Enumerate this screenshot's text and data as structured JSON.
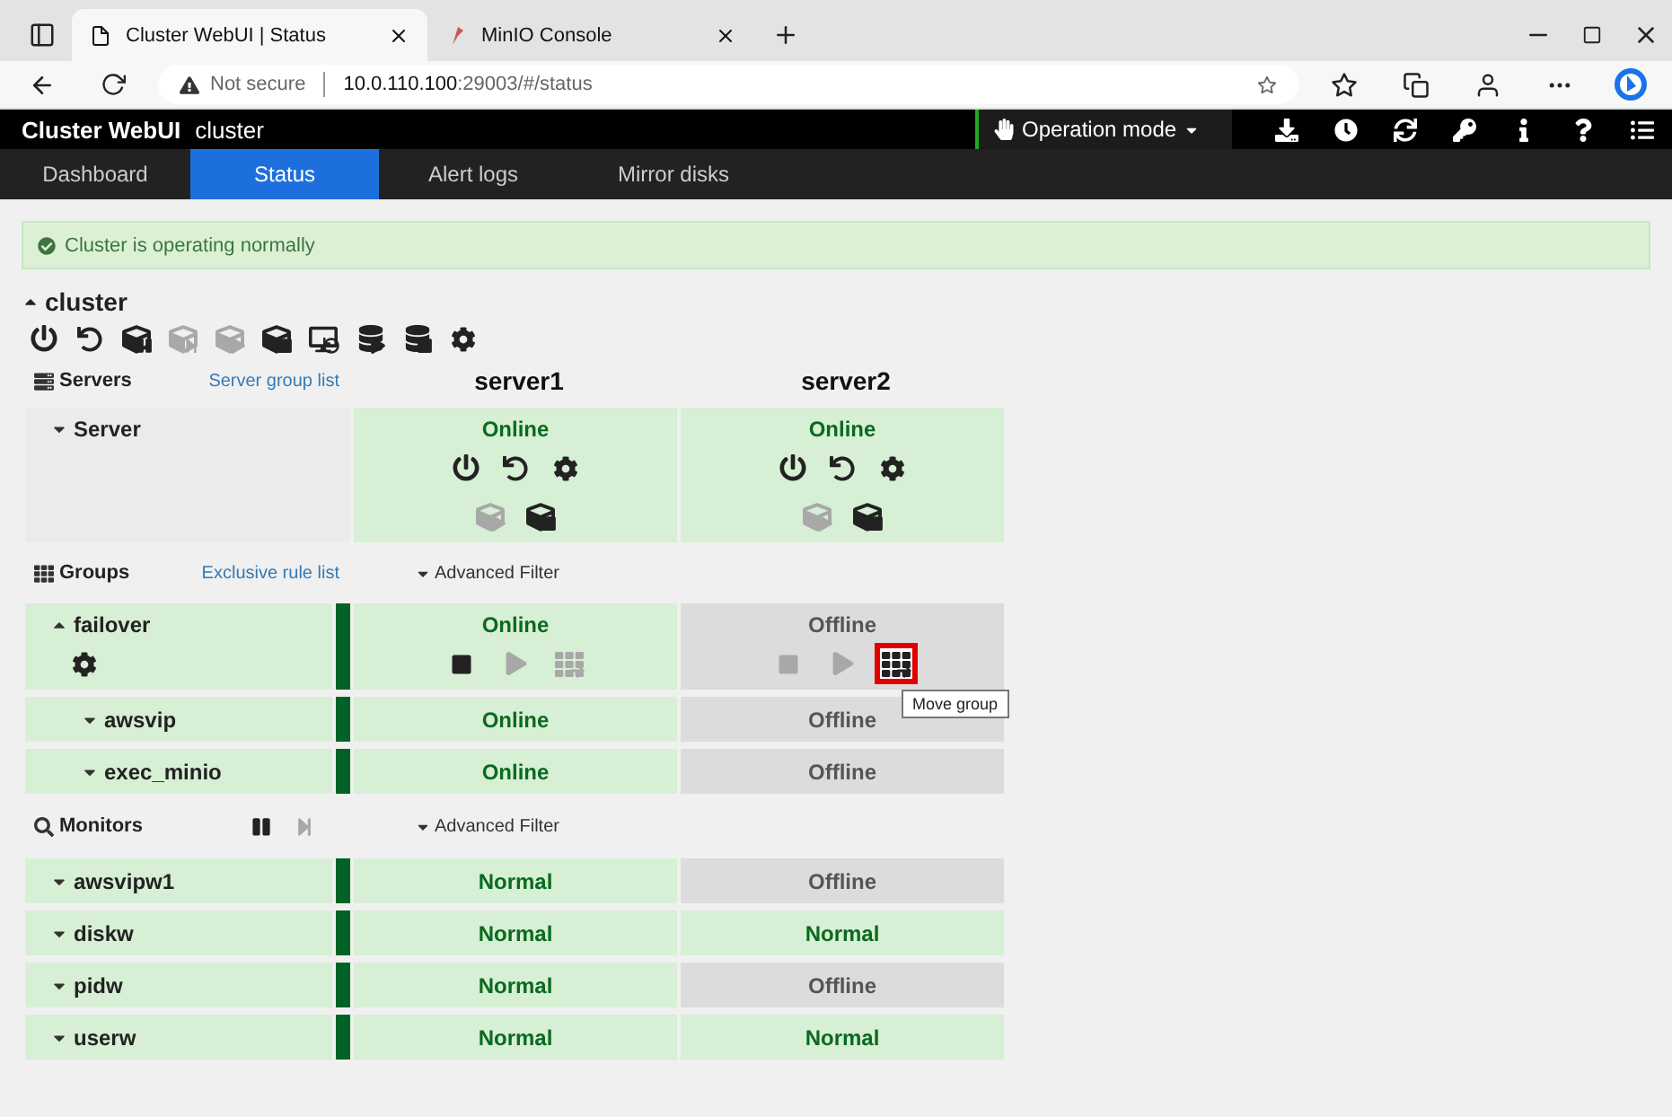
{
  "browser": {
    "tabs": [
      {
        "title": "Cluster WebUI | Status",
        "selected": true
      },
      {
        "title": "MinIO Console",
        "selected": false
      }
    ],
    "security": "Not secure",
    "url_host": "10.0.110.100",
    "url_rest": ":29003/#/status"
  },
  "app": {
    "title": "Cluster WebUI",
    "cluster": "cluster",
    "mode": "Operation mode"
  },
  "nav": [
    {
      "label": "Dashboard",
      "selected": false
    },
    {
      "label": "Status",
      "selected": true
    },
    {
      "label": "Alert logs",
      "selected": false
    },
    {
      "label": "Mirror disks",
      "selected": false
    }
  ],
  "alert": {
    "text": "Cluster is operating normally",
    "healthy": true
  },
  "cluster": {
    "name": "cluster",
    "expanded": true,
    "actions": [
      {
        "kind": "power",
        "disabled": false
      },
      {
        "kind": "restart",
        "disabled": false
      },
      {
        "kind": "cube-pause",
        "disabled": false
      },
      {
        "kind": "cube-resume",
        "disabled": true
      },
      {
        "kind": "cube-play",
        "disabled": true
      },
      {
        "kind": "cube-stop",
        "disabled": false
      },
      {
        "kind": "screen-restart",
        "disabled": false
      },
      {
        "kind": "db-play",
        "disabled": false
      },
      {
        "kind": "db-stop",
        "disabled": false
      },
      {
        "kind": "gear",
        "disabled": false
      }
    ]
  },
  "servers": {
    "title": "Servers",
    "link": "Server group list",
    "columns": [
      "server1",
      "server2"
    ],
    "rows": [
      {
        "name": "Server",
        "expanded": false,
        "cells": [
          {
            "status": "Online",
            "offline": false,
            "action_rows": [
              [
                {
                  "kind": "power",
                  "disabled": false
                },
                {
                  "kind": "restart",
                  "disabled": false
                },
                {
                  "kind": "gear",
                  "disabled": false
                }
              ],
              [
                {
                  "kind": "cube-play",
                  "disabled": true
                },
                {
                  "kind": "cube-stop",
                  "disabled": false
                }
              ]
            ]
          },
          {
            "status": "Online",
            "offline": false,
            "action_rows": [
              [
                {
                  "kind": "power",
                  "disabled": false
                },
                {
                  "kind": "restart",
                  "disabled": false
                },
                {
                  "kind": "gear",
                  "disabled": false
                }
              ],
              [
                {
                  "kind": "cube-play",
                  "disabled": true
                },
                {
                  "kind": "cube-stop",
                  "disabled": false
                }
              ]
            ]
          }
        ]
      }
    ]
  },
  "groups": {
    "title": "Groups",
    "link": "Exclusive rule list",
    "filter": "Advanced Filter",
    "rows": [
      {
        "name": "failover",
        "expanded": true,
        "kind": "group",
        "healthy": true,
        "label_actions": [
          {
            "kind": "gear",
            "disabled": false
          }
        ],
        "cells": [
          {
            "status": "Online",
            "offline": false,
            "actions": [
              {
                "kind": "stop",
                "disabled": false
              },
              {
                "kind": "play",
                "disabled": true
              },
              {
                "kind": "move",
                "disabled": true
              }
            ]
          },
          {
            "status": "Offline",
            "offline": true,
            "actions": [
              {
                "kind": "stop",
                "disabled": true
              },
              {
                "kind": "play",
                "disabled": true
              },
              {
                "kind": "move",
                "disabled": false,
                "highlighted": true,
                "tooltip": "Move group"
              }
            ]
          }
        ]
      },
      {
        "name": "awsvip",
        "expanded": false,
        "kind": "resource",
        "healthy": true,
        "cells": [
          {
            "status": "Online",
            "offline": false
          },
          {
            "status": "Offline",
            "offline": true
          }
        ]
      },
      {
        "name": "exec_minio",
        "expanded": false,
        "kind": "resource",
        "healthy": true,
        "cells": [
          {
            "status": "Online",
            "offline": false
          },
          {
            "status": "Offline",
            "offline": true
          }
        ]
      }
    ]
  },
  "monitors": {
    "title": "Monitors",
    "filter": "Advanced Filter",
    "controls": [
      {
        "kind": "pause",
        "disabled": false
      },
      {
        "kind": "resume",
        "disabled": true
      }
    ],
    "rows": [
      {
        "name": "awsvipw1",
        "expanded": false,
        "healthy": true,
        "cells": [
          {
            "status": "Normal",
            "offline": false
          },
          {
            "status": "Offline",
            "offline": true
          }
        ]
      },
      {
        "name": "diskw",
        "expanded": false,
        "healthy": true,
        "cells": [
          {
            "status": "Normal",
            "offline": false
          },
          {
            "status": "Normal",
            "offline": false
          }
        ]
      },
      {
        "name": "pidw",
        "expanded": false,
        "healthy": true,
        "cells": [
          {
            "status": "Normal",
            "offline": false
          },
          {
            "status": "Offline",
            "offline": true
          }
        ]
      },
      {
        "name": "userw",
        "expanded": false,
        "healthy": true,
        "cells": [
          {
            "status": "Normal",
            "offline": false
          },
          {
            "status": "Normal",
            "offline": false
          }
        ]
      }
    ]
  }
}
